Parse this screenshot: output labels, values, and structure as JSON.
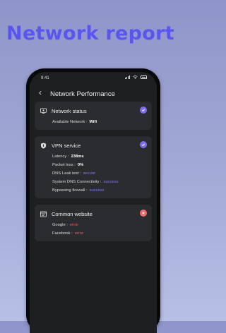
{
  "headline": "Network report",
  "status_bar": {
    "time": "9:41"
  },
  "nav": {
    "back_icon": "chevron-left-icon",
    "title": "Network Performance"
  },
  "cards": [
    {
      "title": "Network status",
      "icon": "network-icon",
      "status": "ok",
      "rows": [
        {
          "label": "Available Network :",
          "value": "Wifi",
          "color": "#ffffff"
        }
      ]
    },
    {
      "title": "VPN service",
      "icon": "shield-icon",
      "status": "ok",
      "rows": [
        {
          "label": "Latency :",
          "value": "238ms",
          "color": "#ffffff"
        },
        {
          "label": "Packet loss :",
          "value": "0%",
          "color": "#ffffff"
        },
        {
          "label": "DNS Leak test :",
          "value": "secure",
          "color": "#7f7cf7"
        },
        {
          "label": "System DNS Connectivity :",
          "value": "success",
          "color": "#7f7cf7"
        },
        {
          "label": "Bypassing firewall :",
          "value": "success",
          "color": "#7f7cf7"
        }
      ]
    },
    {
      "title": "Common website",
      "icon": "globe-icon",
      "status": "error",
      "rows": [
        {
          "label": "Google :",
          "value": "error",
          "color": "#f05c5c"
        },
        {
          "label": "Facebook :",
          "value": "error",
          "color": "#f05c5c"
        }
      ]
    }
  ],
  "colors": {
    "accent": "#7f6cf0",
    "error": "#f06a6a",
    "headline": "#5b55f0"
  }
}
